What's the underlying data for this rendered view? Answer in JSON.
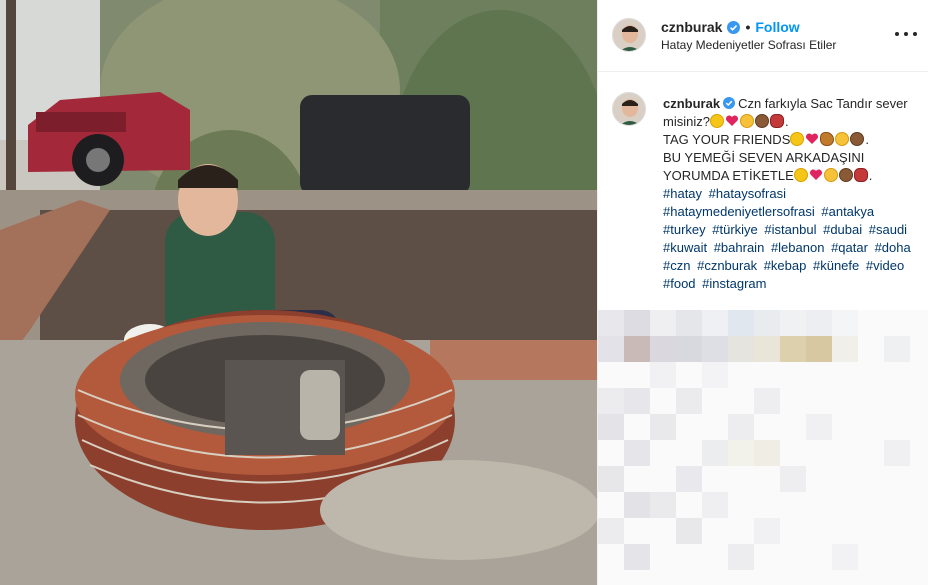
{
  "post": {
    "username": "cznburak",
    "follow_label": "Follow",
    "separator": "•",
    "location": "Hatay Medeniyetler Sofrası Etiler",
    "more_label": "More options"
  },
  "caption": {
    "username": "cznburak",
    "line1": "Czn farkıyla Sac Tandır sever misiniz?",
    "line2": "TAG YOUR FRIENDS",
    "line3": "BU YEMEĞİ SEVEN ARKADAŞINI YORUMDA ETİKETLE",
    "hashtags": [
      "#hatay",
      "#hataysofrasi",
      "#hataymedeniyetlersofrasi",
      "#antakya",
      "#turkey",
      "#türkiye",
      "#istanbul",
      "#dubai",
      "#saudi",
      "#kuwait",
      "#bahrain",
      "#lebanon",
      "#qatar",
      "#doha",
      "#czn",
      "#cznburak",
      "#kebap",
      "#künefe",
      "#video",
      "#food",
      "#instagram"
    ]
  },
  "colors": {
    "follow": "#0095f6",
    "hashtag": "#00376b",
    "text": "#262626",
    "verified": "#3897f0"
  },
  "icons": {
    "verified": "verified-badge-icon",
    "more": "more-horizontal-icon"
  }
}
